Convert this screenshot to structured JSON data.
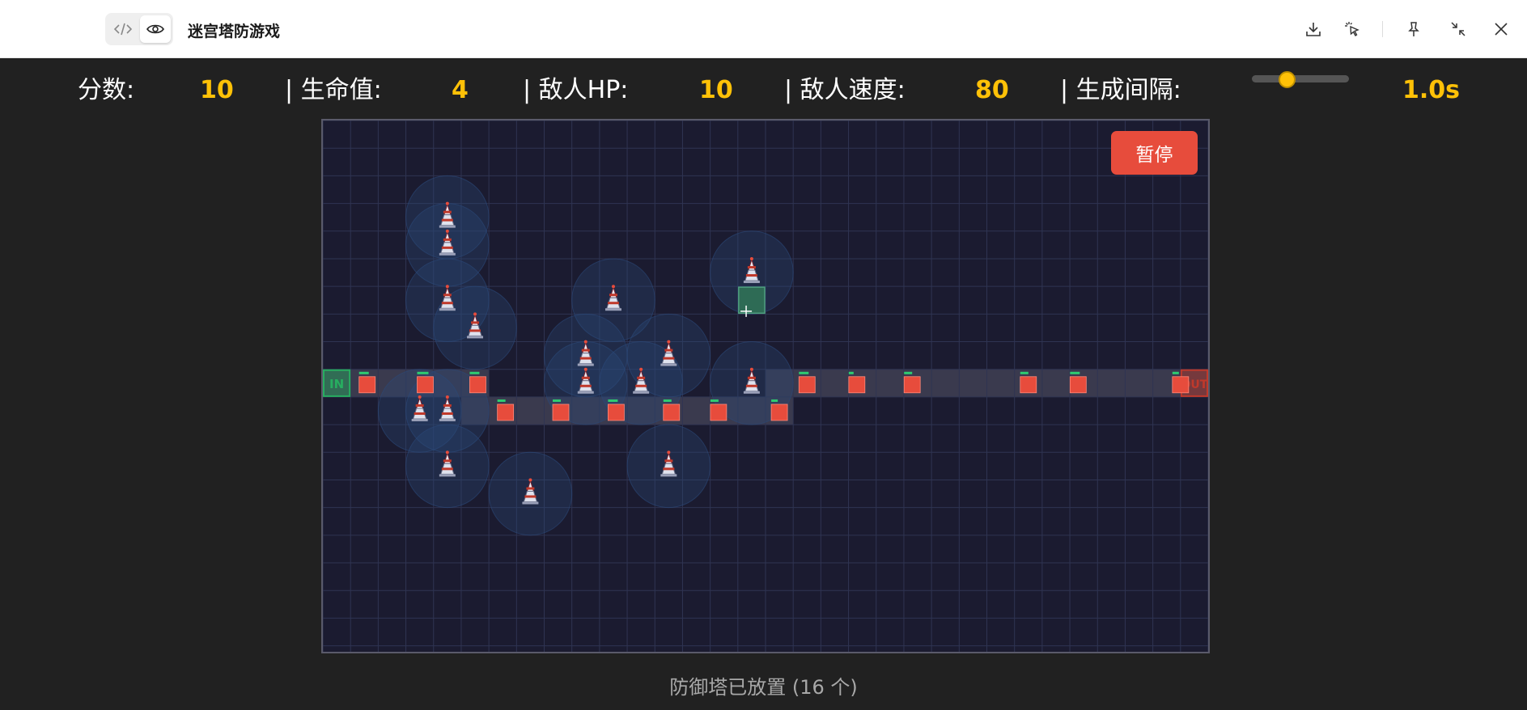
{
  "window": {
    "title": "迷宫塔防游戏",
    "icons": [
      "code-icon",
      "eye-icon",
      "download-icon",
      "pointer-click-icon",
      "pin-icon",
      "collapse-icon",
      "close-icon"
    ]
  },
  "stats": {
    "score_label": "分数:",
    "score": "10",
    "lives_label": "| 生命值:",
    "lives": "4",
    "enemy_hp_label": "| 敌人HP:",
    "enemy_hp": "10",
    "enemy_speed_label": "| 敌人速度:",
    "enemy_speed": "80",
    "spawn_interval_label": "| 生成间隔:",
    "spawn_interval": "1.0s",
    "spawn_slider_fraction": 0.36
  },
  "controls": {
    "pause_label": "暂停"
  },
  "board": {
    "cols": 32,
    "rows": 19,
    "entry_label": "IN",
    "exit_label": "OUT",
    "hover_cell": [
      15,
      6
    ],
    "colors": {
      "background": "#1b1b30",
      "grid": "#2f3452",
      "path": "#3a3a4e",
      "entry": "#27ae60",
      "exit": "#c0392b",
      "enemy": "#e74c3c",
      "enemy_health": "#2ecc71",
      "tower_range": "#2c4a7a",
      "hover": "#2e6b55"
    },
    "path_cells": [
      [
        0,
        9
      ],
      [
        1,
        9
      ],
      [
        2,
        9
      ],
      [
        3,
        9
      ],
      [
        4,
        9
      ],
      [
        5,
        9
      ],
      [
        5,
        10
      ],
      [
        6,
        10
      ],
      [
        7,
        10
      ],
      [
        8,
        10
      ],
      [
        9,
        10
      ],
      [
        10,
        10
      ],
      [
        11,
        10
      ],
      [
        12,
        10
      ],
      [
        13,
        10
      ],
      [
        14,
        10
      ],
      [
        15,
        10
      ],
      [
        16,
        10
      ],
      [
        16,
        9
      ],
      [
        17,
        9
      ],
      [
        18,
        9
      ],
      [
        19,
        9
      ],
      [
        20,
        9
      ],
      [
        21,
        9
      ],
      [
        22,
        9
      ],
      [
        23,
        9
      ],
      [
        24,
        9
      ],
      [
        25,
        9
      ],
      [
        26,
        9
      ],
      [
        27,
        9
      ],
      [
        28,
        9
      ],
      [
        29,
        9
      ],
      [
        30,
        9
      ],
      [
        31,
        9
      ]
    ],
    "towers": [
      [
        4,
        3
      ],
      [
        4,
        4
      ],
      [
        4,
        6
      ],
      [
        5,
        7
      ],
      [
        10,
        6
      ],
      [
        15,
        5
      ],
      [
        9,
        8
      ],
      [
        12,
        8
      ],
      [
        9,
        9
      ],
      [
        11,
        9
      ],
      [
        15,
        9
      ],
      [
        3,
        10
      ],
      [
        4,
        10
      ],
      [
        4,
        12
      ],
      [
        7,
        13
      ],
      [
        12,
        12
      ]
    ],
    "enemies": [
      [
        1.1,
        9,
        0.6
      ],
      [
        3.2,
        9,
        0.7
      ],
      [
        5.1,
        9,
        0.6
      ],
      [
        6.1,
        10,
        0.5
      ],
      [
        8.1,
        10,
        0.5
      ],
      [
        10.1,
        10,
        0.6
      ],
      [
        12.1,
        10,
        0.5
      ],
      [
        13.8,
        10,
        0.5
      ],
      [
        16.0,
        10,
        0.4
      ],
      [
        17.0,
        9,
        0.6
      ],
      [
        18.8,
        9,
        0.3
      ],
      [
        20.8,
        9,
        0.5
      ],
      [
        25.0,
        9,
        0.5
      ],
      [
        26.8,
        9,
        0.6
      ],
      [
        30.5,
        9,
        0.4
      ]
    ]
  },
  "status": {
    "message": "防御塔已放置 (16 个)"
  }
}
